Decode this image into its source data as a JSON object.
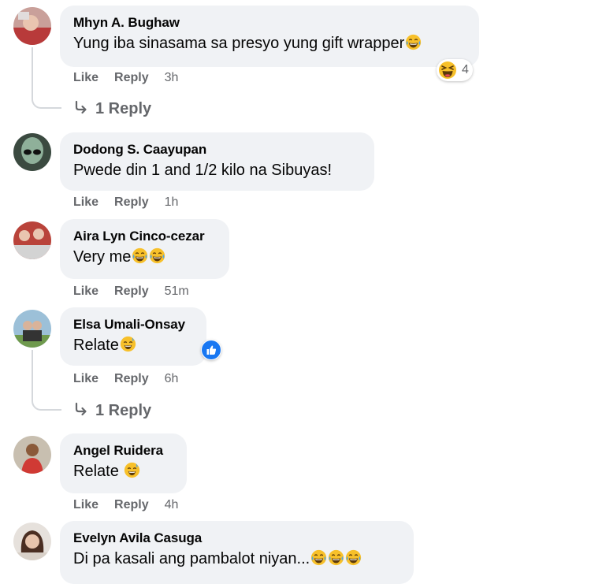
{
  "colors": {
    "bubble_bg": "#f0f2f5",
    "name_text": "#050505",
    "meta_text": "#65676b",
    "like_blue": "#1877f2",
    "emoji_yellow": "#f7c02a"
  },
  "comments": [
    {
      "author": "Mhyn A. Bughaw",
      "text": "Yung iba sinasama sa presyo yung gift wrapper",
      "emoji_suffix": [
        "tears-of-joy-emoji"
      ],
      "like_label": "Like",
      "reply_label": "Reply",
      "time": "3h",
      "reaction": {
        "icon": "laughing-reaction-icon",
        "count": "4"
      },
      "replies_label": "1 Reply"
    },
    {
      "author": "Dodong S. Caayupan",
      "text": "Pwede din 1 and 1/2 kilo na Sibuyas!",
      "like_label": "Like",
      "reply_label": "Reply",
      "time": "1h"
    },
    {
      "author": "Aira Lyn Cinco-cezar",
      "text": "Very me",
      "emoji_suffix": [
        "tears-of-joy-emoji",
        "tears-of-joy-emoji"
      ],
      "like_label": "Like",
      "reply_label": "Reply",
      "time": "51m"
    },
    {
      "author": "Elsa Umali-Onsay",
      "text": "Relate",
      "emoji_suffix": [
        "grinning-sweat-emoji"
      ],
      "like_label": "Like",
      "reply_label": "Reply",
      "time": "6h",
      "reaction": {
        "icon": "like-reaction-icon"
      },
      "replies_label": "1 Reply"
    },
    {
      "author": "Angel Ruidera",
      "text": "Relate ",
      "emoji_suffix": [
        "grinning-sweat-emoji"
      ],
      "like_label": "Like",
      "reply_label": "Reply",
      "time": "4h"
    },
    {
      "author": "Evelyn Avila Casuga",
      "text": "Di pa kasali ang pambalot niyan...",
      "emoji_suffix": [
        "tears-of-joy-emoji",
        "tears-of-joy-emoji",
        "tears-of-joy-emoji"
      ]
    }
  ]
}
